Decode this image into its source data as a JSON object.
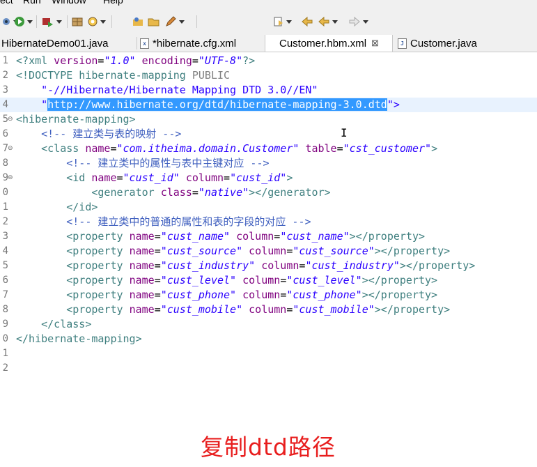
{
  "menubar": {
    "items": [
      "ect",
      "Run",
      "Window",
      "Help"
    ]
  },
  "toolbar": {
    "icons": [
      "debug-icon",
      "run-icon",
      "external-tools-icon",
      "build-icon",
      "refresh-icon",
      "open-type-icon",
      "open-folder-icon",
      "pen-icon",
      "next-annotation-icon",
      "back-icon",
      "forward-icon"
    ]
  },
  "tabs": [
    {
      "label": "HibernateDemo01.java",
      "active": false
    },
    {
      "label": "*hibernate.cfg.xml",
      "active": false,
      "icon": "x"
    },
    {
      "label": "Customer.hbm.xml",
      "active": true,
      "icon": "x",
      "close": "⊠"
    },
    {
      "label": "Customer.java",
      "active": false,
      "icon": "J"
    }
  ],
  "editor": {
    "line_numbers": [
      "1",
      "2",
      "3",
      "4",
      "5",
      "6",
      "7",
      "8",
      "9",
      "0",
      "1",
      "2",
      "3",
      "4",
      "5",
      "6",
      "7",
      "8",
      "9",
      "0",
      "1",
      "2"
    ],
    "lines": {
      "l1": {
        "p1": "<?",
        "p2": "xml",
        "p3": " version",
        "p4": "=",
        "p5": "\"1.0\"",
        "p6": " encoding",
        "p7": "=",
        "p8": "\"UTF-8\"",
        "p9": "?>"
      },
      "l2": {
        "p1": "<!DOCTYPE",
        "p2": " hibernate-mapping ",
        "p3": "PUBLIC"
      },
      "l3": {
        "p1": "    \"-//Hibernate/Hibernate Mapping DTD 3.0//EN\""
      },
      "l4": {
        "p1": "    \"",
        "sel": "http://www.hibernate.org/dtd/hibernate-mapping-3.0.dtd",
        "p2": "\">"
      },
      "l5": {
        "p1": "<hibernate-mapping>"
      },
      "l6": {
        "p1": "    <!-- 建立类与表的映射 -->"
      },
      "l7": {
        "p1": "    <class ",
        "p2": "name",
        "p3": "=",
        "p4": "\"com.itheima.domain.Customer\"",
        "p5": " table",
        "p6": "=",
        "p7": "\"cst_customer\"",
        "p8": ">"
      },
      "l8": {
        "p1": "        <!-- 建立类中的属性与表中主键对应 -->"
      },
      "l9": {
        "p1": "        <id ",
        "p2": "name",
        "p3": "=",
        "p4": "\"cust_id\"",
        "p5": " column",
        "p6": "=",
        "p7": "\"cust_id\"",
        "p8": ">"
      },
      "l10": {
        "p1": "            <generator ",
        "p2": "class",
        "p3": "=",
        "p4": "\"native\"",
        "p5": "></generator>"
      },
      "l11": {
        "p1": "        </id>"
      },
      "l12": {
        "p1": "        <!-- 建立类中的普通的属性和表的字段的对应 -->"
      },
      "l13": {
        "p1": "        <property ",
        "p2": "name",
        "p3": "=",
        "p4": "\"cust_name\"",
        "p5": " column",
        "p6": "=",
        "p7": "\"cust_name\"",
        "p8": "></property>"
      },
      "l14": {
        "p1": "        <property ",
        "p2": "name",
        "p3": "=",
        "p4": "\"cust_source\"",
        "p5": " column",
        "p6": "=",
        "p7": "\"cust_source\"",
        "p8": "></property>"
      },
      "l15": {
        "p1": "        <property ",
        "p2": "name",
        "p3": "=",
        "p4": "\"cust_industry\"",
        "p5": " column",
        "p6": "=",
        "p7": "\"cust_industry\"",
        "p8": "></property>"
      },
      "l16": {
        "p1": "        <property ",
        "p2": "name",
        "p3": "=",
        "p4": "\"cust_level\"",
        "p5": " column",
        "p6": "=",
        "p7": "\"cust_level\"",
        "p8": "></property>"
      },
      "l17": {
        "p1": "        <property ",
        "p2": "name",
        "p3": "=",
        "p4": "\"cust_phone\"",
        "p5": " column",
        "p6": "=",
        "p7": "\"cust_phone\"",
        "p8": "></property>"
      },
      "l18": {
        "p1": "        <property ",
        "p2": "name",
        "p3": "=",
        "p4": "\"cust_mobile\"",
        "p5": " column",
        "p6": "=",
        "p7": "\"cust_mobile\"",
        "p8": "></property>"
      },
      "l19": {
        "p1": "    </class>"
      },
      "l20": {
        "p1": "</hibernate-mapping>"
      }
    }
  },
  "annotation": {
    "text": "复制dtd路径",
    "color": "#e81e1e"
  },
  "colors": {
    "tag": "#3f7f7f",
    "attr": "#7f007f",
    "value": "#2a00ff",
    "comment": "#3f5fbf",
    "selection": "#3399ff"
  }
}
